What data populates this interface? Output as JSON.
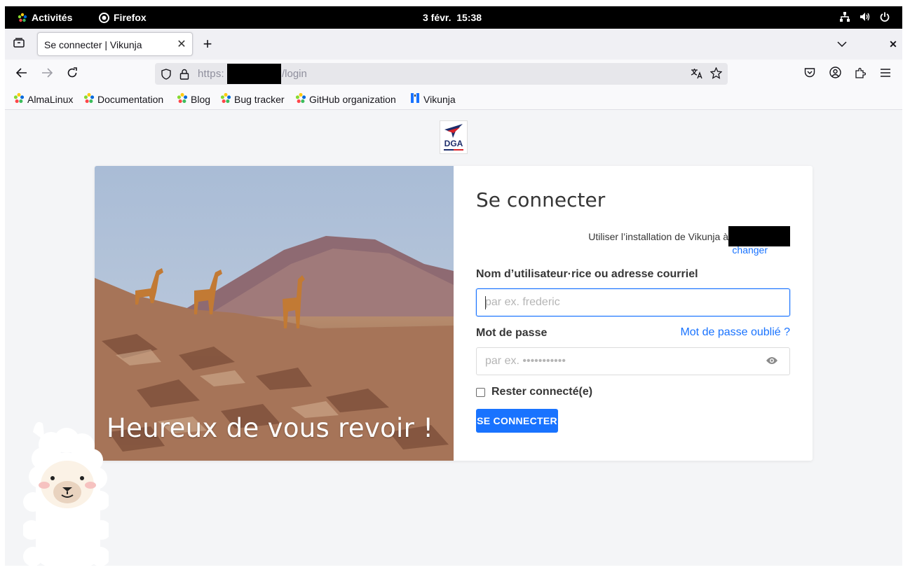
{
  "system": {
    "activities": "Activités",
    "app_name": "Firefox",
    "datetime": "3 févr.  15:38"
  },
  "browser": {
    "tab_title": "Se connecter | Vikunja",
    "url_scheme": "https:",
    "url_path": "/login",
    "bookmarks": [
      {
        "label": "AlmaLinux",
        "icon": "almalinux-icon"
      },
      {
        "label": "Documentation",
        "icon": "almalinux-icon"
      },
      {
        "label": "Blog",
        "icon": "almalinux-icon"
      },
      {
        "label": "Bug tracker",
        "icon": "almalinux-icon"
      },
      {
        "label": "GitHub organization",
        "icon": "almalinux-icon"
      },
      {
        "label": "Vikunja",
        "icon": "vikunja-icon"
      }
    ]
  },
  "page": {
    "logo_text": "DGA",
    "hero_caption": "Heureux de vous revoir !",
    "title": "Se connecter",
    "install_text": "Utiliser l’installation de Vikunja à",
    "change_link": "changer",
    "username_label": "Nom d’utilisateur·rice ou adresse courriel",
    "username_placeholder": "par ex. frederic",
    "password_label": "Mot de passe",
    "forgot_link": "Mot de passe oublié ?",
    "password_placeholder": "par ex. •••••••••••",
    "remember_label": "Rester connecté(e)",
    "submit_label": "SE CONNECTER"
  },
  "colors": {
    "primary": "#1973ff",
    "topbar": "#000000"
  }
}
